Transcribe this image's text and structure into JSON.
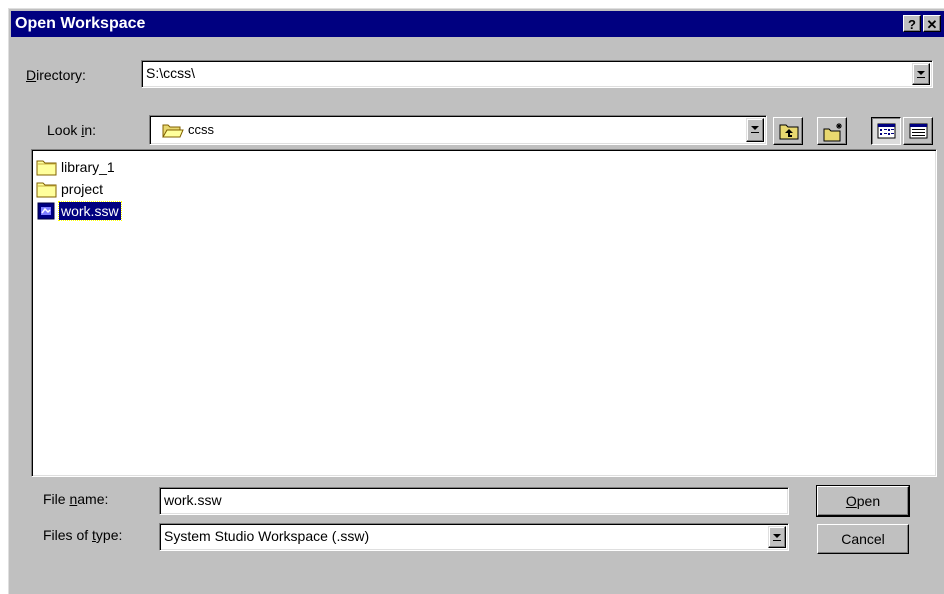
{
  "window": {
    "title": "Open Workspace",
    "help_button": "?",
    "close_button": "✕"
  },
  "directory": {
    "label_prefix": "",
    "label_hotkey": "D",
    "label_rest": "irectory:",
    "value": "S:\\ccss\\"
  },
  "look_in": {
    "label_prefix": "Look ",
    "label_hotkey": "i",
    "label_rest": "n:",
    "value": "ccss",
    "icon": "folder-open-icon"
  },
  "toolbar": {
    "up_icon": "up-one-level-icon",
    "new_folder_icon": "new-folder-icon",
    "list_icon": "list-view-icon",
    "details_icon": "details-view-icon"
  },
  "files": [
    {
      "name": "library_1",
      "icon": "folder-icon",
      "selected": false
    },
    {
      "name": "project",
      "icon": "folder-icon",
      "selected": false
    },
    {
      "name": "work.ssw",
      "icon": "workspace-file-icon",
      "selected": true
    }
  ],
  "file_name": {
    "label_prefix": "File ",
    "label_hotkey": "n",
    "label_rest": "ame:",
    "value": "work.ssw"
  },
  "file_type": {
    "label_prefix": "Files of ",
    "label_hotkey": "t",
    "label_rest": "ype:",
    "value": "System Studio Workspace (.ssw)"
  },
  "buttons": {
    "open_hotkey": "O",
    "open_rest": "pen",
    "cancel": "Cancel"
  },
  "colors": {
    "title_bar": "#000080",
    "face": "#c0c0c0",
    "selection": "#000080"
  }
}
